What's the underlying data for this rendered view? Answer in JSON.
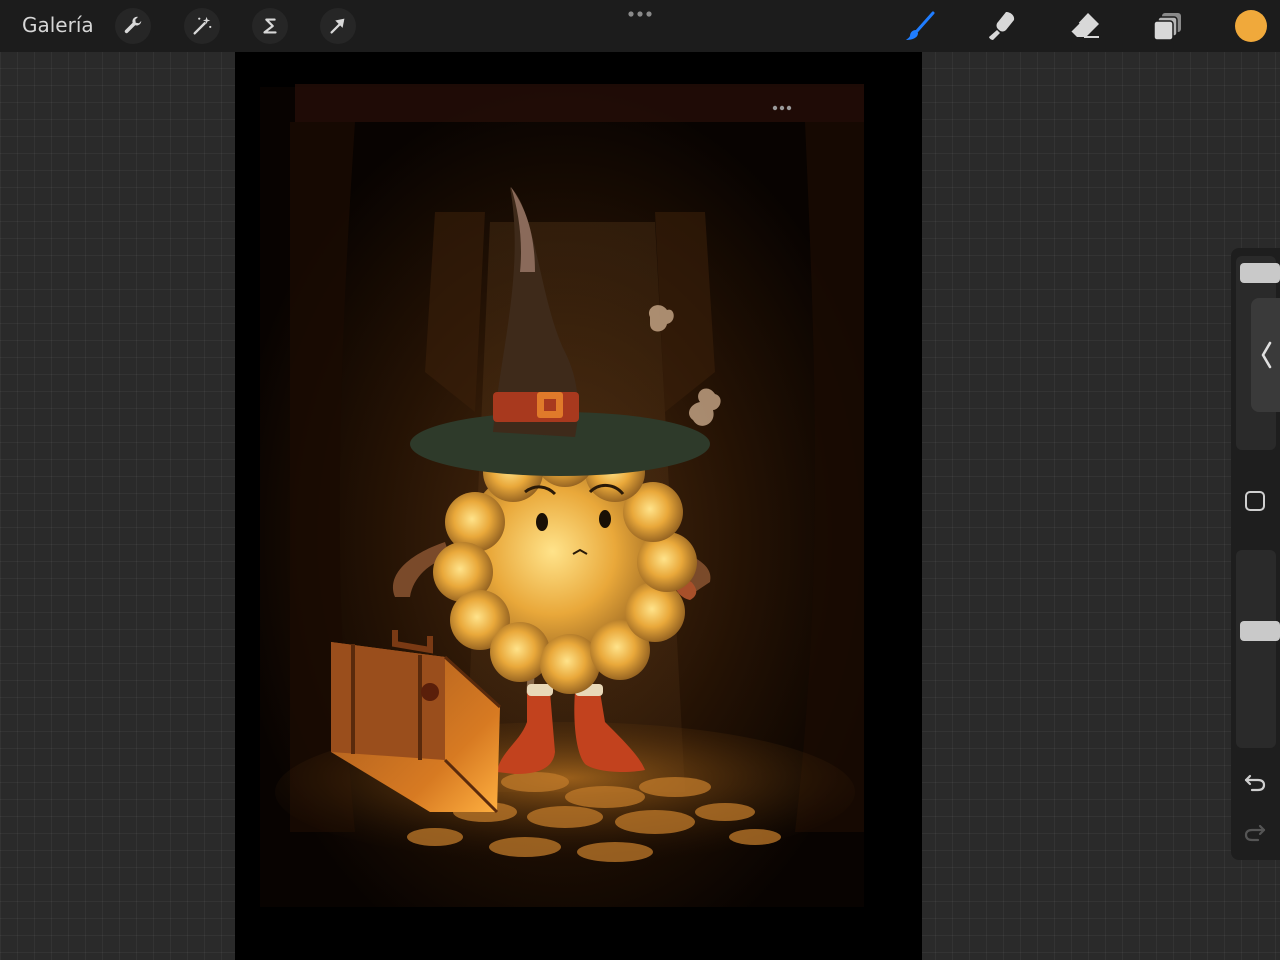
{
  "topbar": {
    "gallery_label": "Galería",
    "left_tools": [
      "wrench-icon",
      "magic-wand-icon",
      "selection-s-icon",
      "transform-arrow-icon"
    ],
    "right_tools": [
      "brush-icon",
      "smudge-icon",
      "eraser-icon",
      "layers-icon"
    ],
    "active_tool": "brush-icon",
    "current_color": "#f0a93b",
    "accent_color": "#1f7dff"
  },
  "sidebar": {
    "brush_size_level": 0.04,
    "opacity_level": 0.6,
    "buttons": [
      "modify-square-icon",
      "undo-icon",
      "redo-icon"
    ]
  },
  "canvas": {
    "artwork": "witch-character-illustration"
  }
}
